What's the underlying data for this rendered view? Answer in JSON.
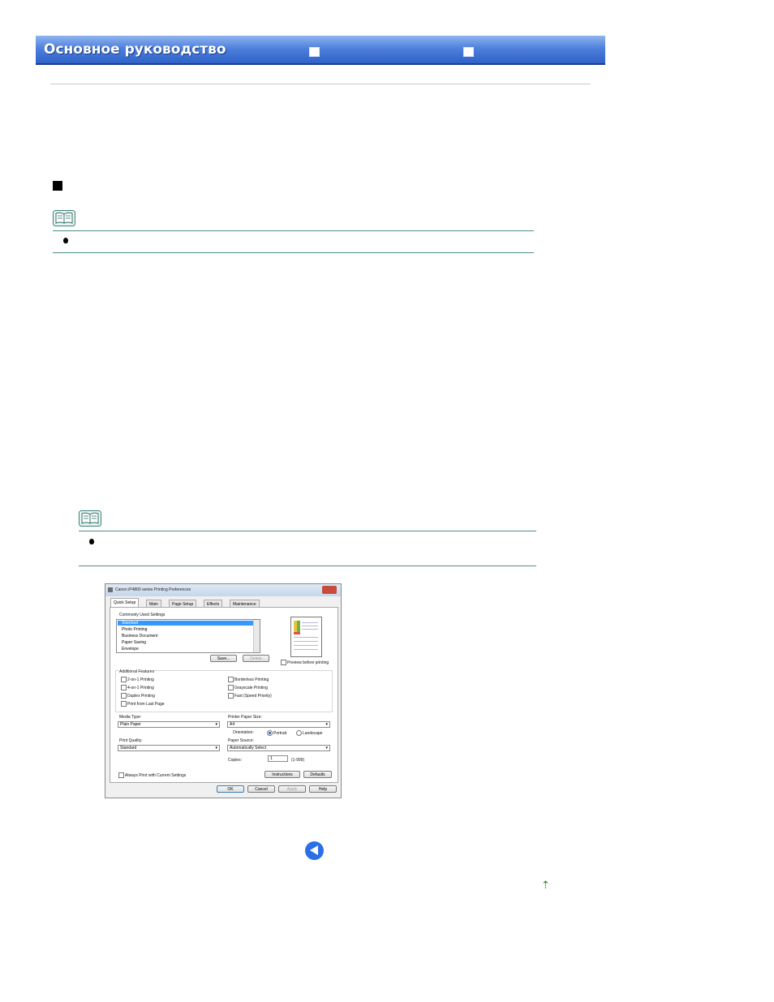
{
  "header": {
    "title": "Основное руководство"
  },
  "dialog": {
    "title": "Canon iP4800 series Printing Preferences",
    "tabs": [
      "Quick Setup",
      "Main",
      "Page Setup",
      "Effects",
      "Maintenance"
    ],
    "commonly_used_label": "Commonly Used Settings",
    "list_items": [
      "Standard",
      "Photo Printing",
      "Business Document",
      "Paper Saving",
      "Envelope"
    ],
    "save_label": "Save...",
    "delete_label": "Delete",
    "preview_before_label": "Preview before printing",
    "additional_features_label": "Additional Features",
    "features_left": [
      "2-on-1 Printing",
      "4-on-1 Printing",
      "Duplex Printing",
      "Print from Last Page"
    ],
    "features_right": [
      "Borderless Printing",
      "Grayscale Printing",
      "Fast (Speed Priority)"
    ],
    "media_type_label": "Media Type:",
    "media_type_value": "Plain Paper",
    "printer_paper_size_label": "Printer Paper Size:",
    "printer_paper_size_value": "A4",
    "orientation_label": "Orientation:",
    "portrait_label": "Portrait",
    "landscape_label": "Landscape",
    "print_quality_label": "Print Quality:",
    "print_quality_value": "Standard",
    "paper_source_label": "Paper Source:",
    "paper_source_value": "Automatically Select",
    "copies_label": "Copies:",
    "copies_value": "1",
    "copies_range": "(1-999)",
    "always_print_label": "Always Print with Current Settings",
    "instructions_label": "Instructions",
    "defaults_label": "Defaults",
    "ok_label": "OK",
    "cancel_label": "Cancel",
    "apply_label": "Apply",
    "help_label": "Help"
  },
  "icons": {
    "back": "back-arrow-icon",
    "top": "up-arrow-icon",
    "note": "note-book-icon"
  },
  "colors": {
    "header_blue": "#2f62c9",
    "note_rule": "#4c8f87",
    "back_button": "#2b6ee6"
  }
}
